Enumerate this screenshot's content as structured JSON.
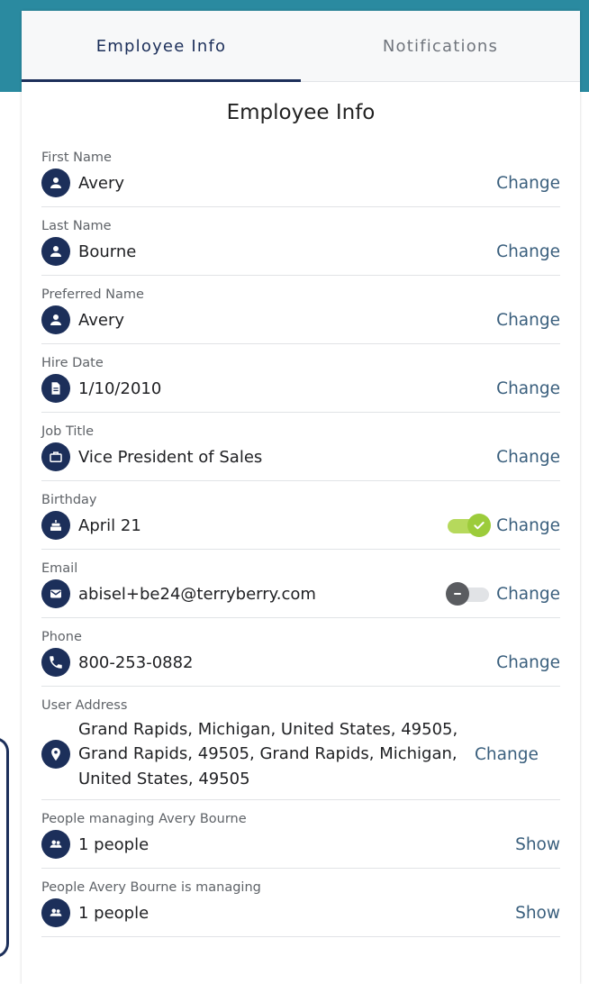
{
  "tabs": [
    {
      "label": "Employee Info",
      "active": true
    },
    {
      "label": "Notifications",
      "active": false
    }
  ],
  "section": {
    "title": "Employee Info"
  },
  "fields": [
    {
      "label": "First Name",
      "value": "Avery",
      "icon": "person-icon",
      "action": "Change"
    },
    {
      "label": "Last Name",
      "value": "Bourne",
      "icon": "person-icon",
      "action": "Change"
    },
    {
      "label": "Preferred Name",
      "value": "Avery",
      "icon": "person-icon",
      "action": "Change"
    },
    {
      "label": "Hire Date",
      "value": "1/10/2010",
      "icon": "document-icon",
      "action": "Change"
    },
    {
      "label": "Job Title",
      "value": "Vice President of Sales",
      "icon": "briefcase-icon",
      "action": "Change"
    },
    {
      "label": "Birthday",
      "value": "April 21",
      "icon": "cake-icon",
      "action": "Change",
      "toggle": "on"
    },
    {
      "label": "Email",
      "value": "abisel+be24@terryberry.com",
      "icon": "envelope-icon",
      "action": "Change",
      "toggle": "off"
    },
    {
      "label": "Phone",
      "value": "800-253-0882",
      "icon": "phone-icon",
      "action": "Change"
    },
    {
      "label": "User Address",
      "value": "Grand Rapids, Michigan, United States, 49505, Grand Rapids, 49505, Grand Rapids, Michigan, United States, 49505",
      "icon": "location-pin-icon",
      "action": "Change"
    },
    {
      "label": "People managing Avery Bourne",
      "value": "1 people",
      "icon": "people-icon",
      "action": "Show"
    },
    {
      "label": "People Avery Bourne is managing",
      "value": "1 people",
      "icon": "people-icon",
      "action": "Show"
    }
  ],
  "colors": {
    "accent": "#1c2f5a",
    "link": "#3a5f7d",
    "toggle_on": "#9ccc3b",
    "toggle_off": "#5a5c60",
    "background_band": "#2a8aa0"
  }
}
